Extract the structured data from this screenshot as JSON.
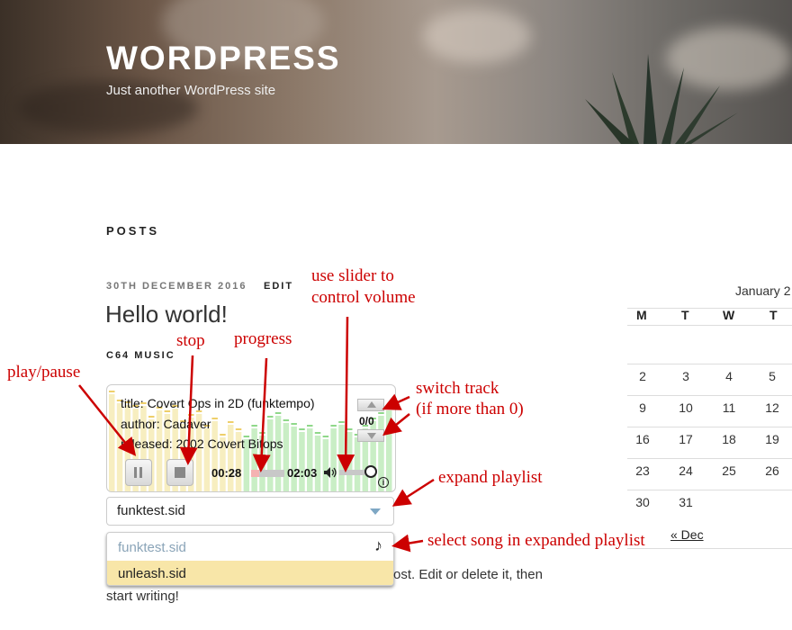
{
  "header": {
    "site_title": "WORDPRESS",
    "site_description": "Just another WordPress site"
  },
  "main": {
    "posts_heading": "POSTS",
    "post": {
      "date": "30TH DECEMBER 2016",
      "edit": "EDIT",
      "title": "Hello world!",
      "section_label": "C64 MUSIC",
      "body_line_1": "ost. Edit or delete it, then",
      "body_line_2": "start writing!"
    }
  },
  "player": {
    "title_line": "title: Covert Ops in 2D (funktempo)",
    "author_line": "author: Cadaver",
    "released_line": "released: 2002 Covert Bitops",
    "pause_icon": "pause-icon",
    "stop_icon": "stop-icon",
    "time_current": "00:28",
    "time_total": "02:03",
    "progress": 0.23,
    "volume": 0.85,
    "track_counter": "0/0",
    "info_icon": "info-icon"
  },
  "playlist": {
    "selected": "funktest.sid",
    "items": [
      {
        "label": "funktest.sid",
        "state": "current"
      },
      {
        "label": "unleash.sid",
        "state": "highlighted"
      }
    ],
    "note_icon": "music-note-icon"
  },
  "calendar": {
    "caption": "January 2",
    "weekdays": [
      "M",
      "T",
      "W",
      "T"
    ],
    "rows": [
      [
        "",
        "",
        "",
        ""
      ],
      [
        "2",
        "3",
        "4",
        "5"
      ],
      [
        "9",
        "10",
        "11",
        "12"
      ],
      [
        "16",
        "17",
        "18",
        "19"
      ],
      [
        "23",
        "24",
        "25",
        "26"
      ],
      [
        "30",
        "31",
        "",
        ""
      ]
    ],
    "prev_link": "« Dec"
  },
  "annotations": {
    "play_pause": "play/pause",
    "stop": "stop",
    "progress": "progress",
    "volume_1": "use slider to",
    "volume_2": "control volume",
    "switch_1": "switch track",
    "switch_2": "(if more than 0)",
    "expand": "expand playlist",
    "select": "select song in expanded playlist"
  },
  "colors": {
    "annotation": "#cc0000",
    "viz_yellow": "#f7eec0",
    "viz_green": "#c9eec5",
    "progress_fill": "#f5b2b2",
    "playlist_highlight": "#f8e6a8",
    "playlist_current_text": "#8aa4b8",
    "select_arrow": "#7ea7c4"
  }
}
